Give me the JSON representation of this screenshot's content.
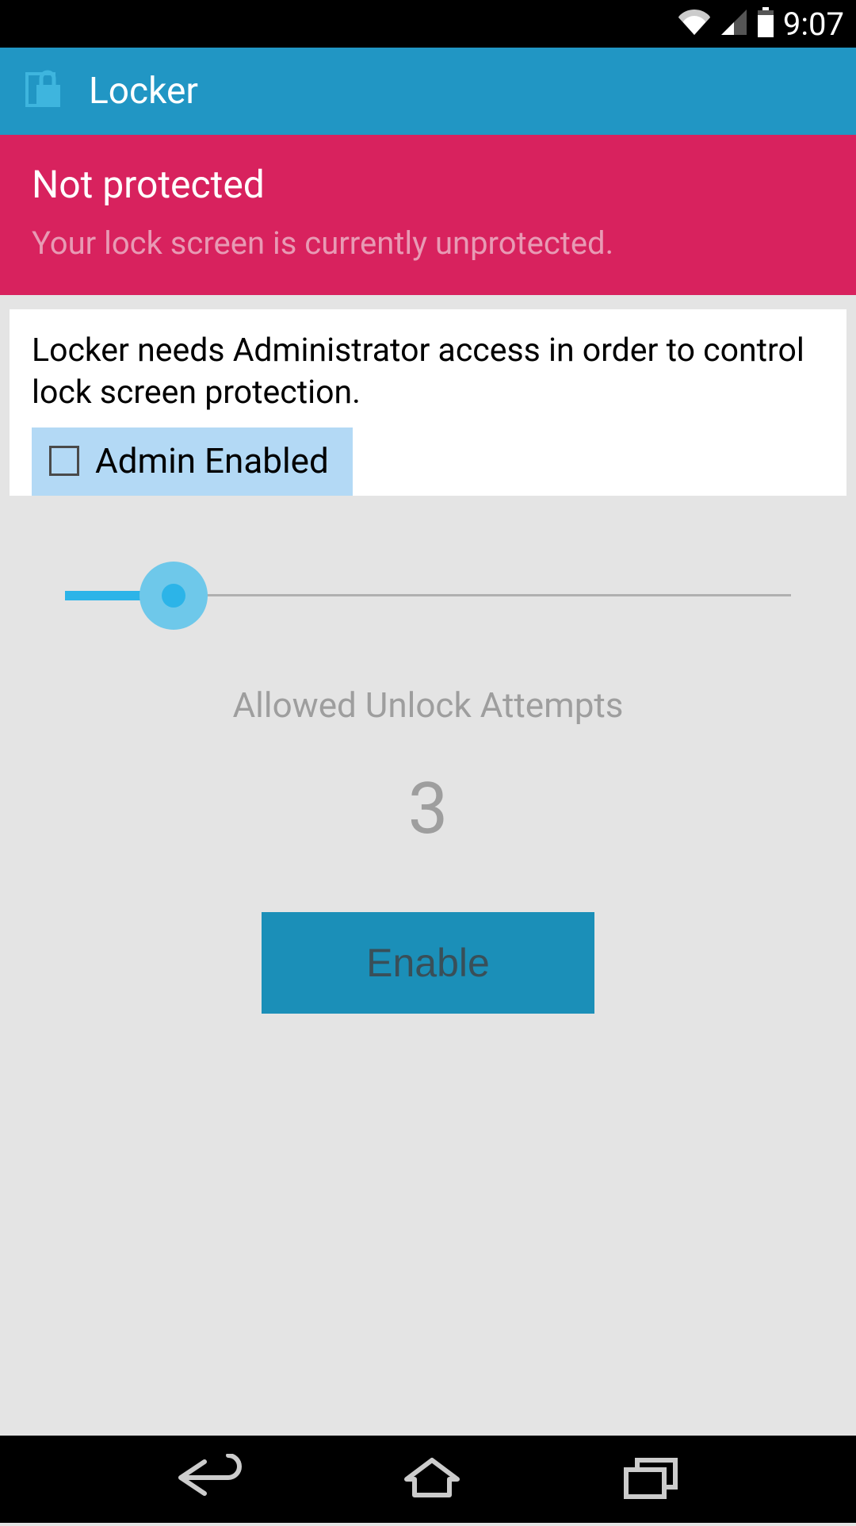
{
  "status_bar": {
    "time": "9:07"
  },
  "app_bar": {
    "title": "Locker",
    "icon": "lock-icon"
  },
  "warning": {
    "title": "Not protected",
    "text": "Your lock screen is currently unprotected."
  },
  "info_card": {
    "text": "Locker needs Administrator access in order to control lock screen protection.",
    "checkbox_label": "Admin Enabled",
    "checkbox_checked": false
  },
  "slider": {
    "label": "Allowed Unlock Attempts",
    "value": "3",
    "position_percent": 15
  },
  "enable_button": {
    "label": "Enable"
  }
}
